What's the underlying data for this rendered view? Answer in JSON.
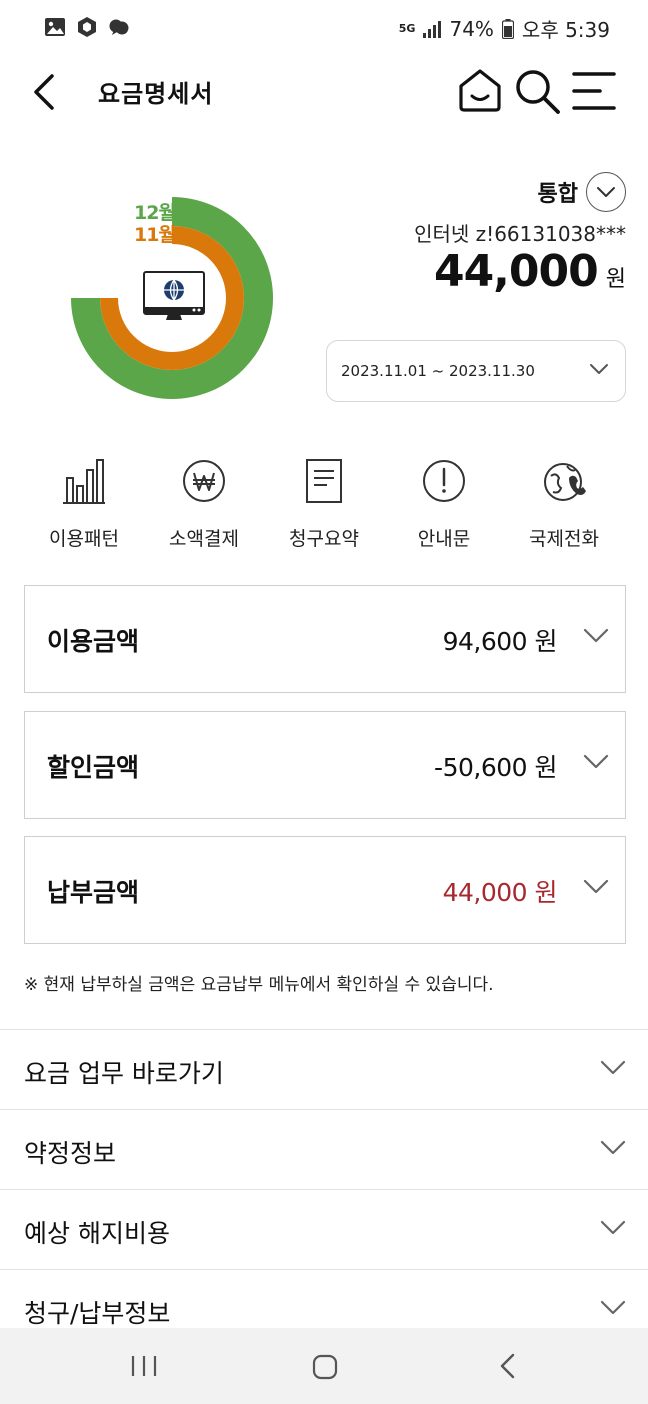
{
  "status_bar": {
    "network": "5G",
    "battery": "74%",
    "time": "오후 5:39"
  },
  "header": {
    "title": "요금명세서",
    "icons": [
      "home-icon",
      "search-icon",
      "menu-icon"
    ]
  },
  "summary": {
    "chart_labels": [
      "12월",
      "11월"
    ],
    "plan": "통합",
    "service": "인터넷 z!66131038***",
    "amount": "44,000",
    "unit": "원",
    "period": "2023.11.01 ~ 2023.11.30",
    "colors": {
      "december": "#5aa648",
      "november": "#d9790b"
    }
  },
  "quick_menu": [
    {
      "label": "이용패턴",
      "icon": "bar-chart-icon"
    },
    {
      "label": "소액결제",
      "icon": "won-coin-icon"
    },
    {
      "label": "청구요약",
      "icon": "document-icon"
    },
    {
      "label": "안내문",
      "icon": "exclamation-icon"
    },
    {
      "label": "국제전화",
      "icon": "globe-phone-icon"
    }
  ],
  "amount_cards": [
    {
      "title": "이용금액",
      "value": "94,600 원",
      "color": "#111111"
    },
    {
      "title": "할인금액",
      "value": "-50,600 원",
      "color": "#111111"
    },
    {
      "title": "납부금액",
      "value": "44,000 원",
      "color": "#a7282f"
    }
  ],
  "note": "※ 현재 납부하실 금액은 요금납부 메뉴에서 확인하실 수 있습니다.",
  "accordion": [
    {
      "label": "요금 업무 바로가기"
    },
    {
      "label": "약정정보"
    },
    {
      "label": "예상 해지비용"
    },
    {
      "label": "청구/납부정보"
    }
  ]
}
